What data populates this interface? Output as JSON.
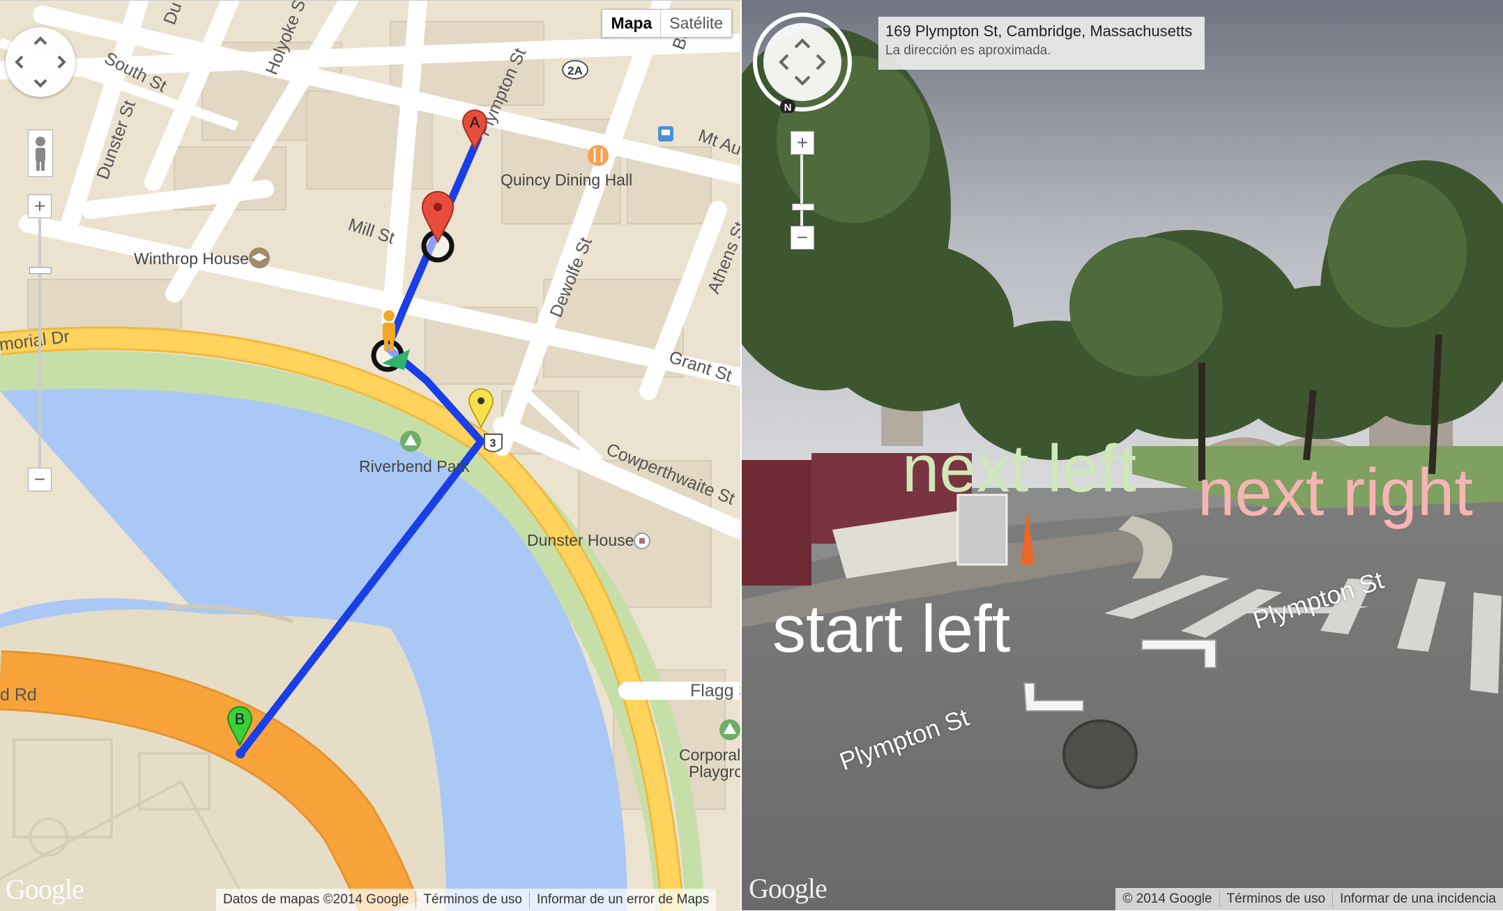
{
  "map": {
    "maptype": {
      "map": "Mapa",
      "satellite": "Satélite"
    },
    "streets": {
      "south_st": "South St",
      "dunster_st": "Dunster St",
      "holyoke_st": "Holyoke St",
      "plympton_st": "Plympton St",
      "bow": "Bow",
      "mt_auburn": "Mt Au",
      "mill_st": "Mill St",
      "dewolfe_st": "Dewolfe St",
      "athens_st": "Athens St",
      "grant_st": "Grant St",
      "memorial_dr": "morial Dr",
      "cowperthwaite_st": "Cowperthwaite St",
      "flagg": "Flagg S",
      "soldiers_rd": "d Rd",
      "du_top": "Du",
      "route_2a": "2A",
      "route_3": "3"
    },
    "pois": {
      "quincy": "Quincy Dining Hall",
      "winthrop": "Winthrop House",
      "riverbend": "Riverbend Park",
      "dunster_house": "Dunster House",
      "corporal": "Corporal",
      "playground": "Playgro"
    },
    "markers": {
      "a": "A",
      "b": "B"
    },
    "footer": {
      "data": "Datos de mapas ©2014 Google",
      "terms": "Términos de uso",
      "report": "Informar de un error de Maps"
    },
    "logo": "Google",
    "colors": {
      "route": "#1a3fe8",
      "highway": "#ffd35c",
      "river": "#a9c8f5",
      "park": "#c6dfa8",
      "orange_road": "#f7a33a"
    }
  },
  "streetview": {
    "address_title": "169 Plympton St, Cambridge, Massachusetts",
    "address_sub": "La dirección es aproximada.",
    "compass_north": "N",
    "overlays": {
      "next_left": "next left",
      "next_right": "next right",
      "start_left": "start left"
    },
    "street_labels": {
      "near": "Plympton St",
      "far": "Plympton St"
    },
    "footer": {
      "copyright": "© 2014 Google",
      "terms": "Términos de uso",
      "report": "Informar de una incidencia"
    },
    "logo": "Google",
    "colors": {
      "next_left": "#cfe8b8",
      "next_right": "#f7b4b4",
      "start_left": "#ffffff"
    }
  }
}
